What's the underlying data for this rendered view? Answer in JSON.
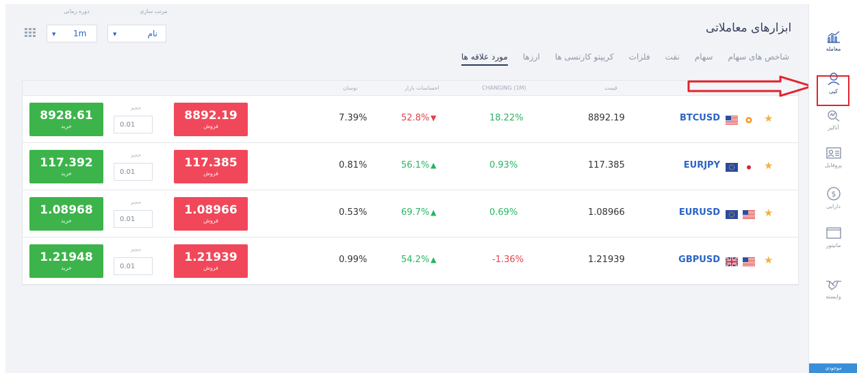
{
  "header": {
    "title": "ابزارهای معاملاتی",
    "sort_label": "مرتب سازی",
    "sort_value": "نام",
    "period_label": "دوره زمانی",
    "period_value": "1m"
  },
  "tabs": [
    {
      "label": "مورد علاقه ها",
      "active": true
    },
    {
      "label": "ارزها",
      "active": false
    },
    {
      "label": "کریپتو کارنسی ها",
      "active": false
    },
    {
      "label": "فلزات",
      "active": false
    },
    {
      "label": "نفت",
      "active": false
    },
    {
      "label": "سهام",
      "active": false
    },
    {
      "label": "شاخص های سهام",
      "active": false
    }
  ],
  "columns": {
    "symbol": "",
    "price": "قیمت",
    "changing": "CHANGING (1M)",
    "sentiment": "احساسات بازار",
    "volatility": "نوسان"
  },
  "rows": [
    {
      "symbol": "BTCUSD",
      "price": "8892.19",
      "changing": "18.22%",
      "changing_dir": "pos",
      "sentiment": "52.8%",
      "sentiment_dir": "down",
      "volatility": "7.39%",
      "sell": "8892.19",
      "buy": "8928.61",
      "volume": "0.01",
      "flags": [
        "us",
        "btc"
      ]
    },
    {
      "symbol": "EURJPY",
      "price": "117.385",
      "changing": "0.93%",
      "changing_dir": "pos",
      "sentiment": "56.1%",
      "sentiment_dir": "up",
      "volatility": "0.81%",
      "sell": "117.385",
      "buy": "117.392",
      "volume": "0.01",
      "flags": [
        "eu",
        "jp"
      ]
    },
    {
      "symbol": "EURUSD",
      "price": "1.08966",
      "changing": "0.69%",
      "changing_dir": "pos",
      "sentiment": "69.7%",
      "sentiment_dir": "up",
      "volatility": "0.53%",
      "sell": "1.08966",
      "buy": "1.08968",
      "volume": "0.01",
      "flags": [
        "eu",
        "us"
      ]
    },
    {
      "symbol": "GBPUSD",
      "price": "1.21939",
      "changing": "-1.36%",
      "changing_dir": "neg",
      "sentiment": "54.2%",
      "sentiment_dir": "up",
      "volatility": "0.99%",
      "sell": "1.21939",
      "buy": "1.21948",
      "volume": "0.01",
      "flags": [
        "gb",
        "us"
      ]
    }
  ],
  "labels": {
    "sell": "فروش",
    "buy": "خرید",
    "volume": "حجم"
  },
  "sidebar": [
    {
      "label": "معامله",
      "icon": "trade-chart-icon"
    },
    {
      "label": "کپی",
      "icon": "copy-user-icon"
    },
    {
      "label": "آنالیز",
      "icon": "analysis-icon"
    },
    {
      "label": "پروفایل",
      "icon": "profile-card-icon"
    },
    {
      "label": "دارایی",
      "icon": "dollar-icon"
    },
    {
      "label": "مانیتور",
      "icon": "monitor-icon"
    },
    {
      "label": "وابسته",
      "icon": "handshake-icon"
    }
  ],
  "sidebar_bottom": "موجودی",
  "colors": {
    "buy": "#3cb44b",
    "sell": "#f0485a",
    "positive": "#28b463",
    "negative": "#e0424e",
    "symbol": "#2b64c6",
    "annotation": "#e0242c"
  }
}
